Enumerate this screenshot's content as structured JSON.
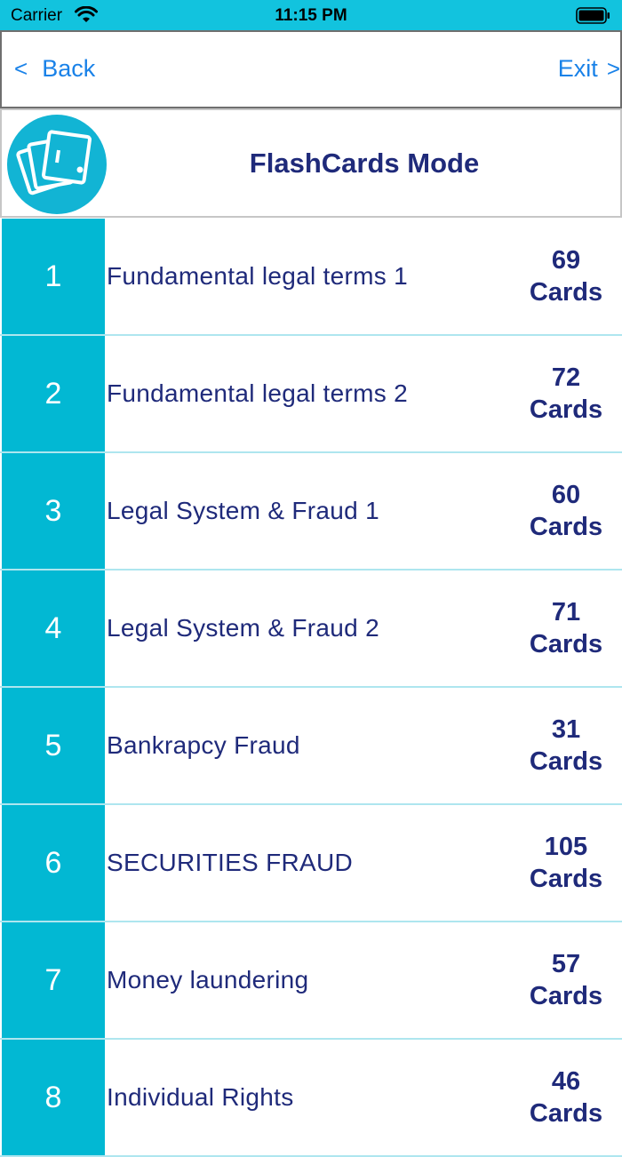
{
  "status_bar": {
    "carrier": "Carrier",
    "time": "11:15 PM"
  },
  "nav": {
    "back_chevron": "<",
    "back_label": "Back",
    "exit_label": "Exit",
    "exit_chevron": ">"
  },
  "header": {
    "title": "FlashCards Mode",
    "logo_icon": "flashcards-icon"
  },
  "colors": {
    "accent": "#02b8d3",
    "status_bar": "#12c3de",
    "text_dark_blue": "#1f2a7a",
    "link_blue": "#1a82e8"
  },
  "decks": [
    {
      "number": "1",
      "title": "Fundamental legal terms 1",
      "count": "69",
      "unit": "Cards"
    },
    {
      "number": "2",
      "title": "Fundamental legal terms 2",
      "count": "72",
      "unit": "Cards"
    },
    {
      "number": "3",
      "title": "Legal System & Fraud 1",
      "count": "60",
      "unit": "Cards"
    },
    {
      "number": "4",
      "title": "Legal System & Fraud 2",
      "count": "71",
      "unit": "Cards"
    },
    {
      "number": "5",
      "title": "Bankrapcy Fraud",
      "count": "31",
      "unit": "Cards"
    },
    {
      "number": "6",
      "title": "SECURITIES FRAUD",
      "count": "105",
      "unit": "Cards"
    },
    {
      "number": "7",
      "title": "Money laundering",
      "count": "57",
      "unit": "Cards"
    },
    {
      "number": "8",
      "title": "Individual Rights",
      "count": "46",
      "unit": "Cards"
    }
  ]
}
